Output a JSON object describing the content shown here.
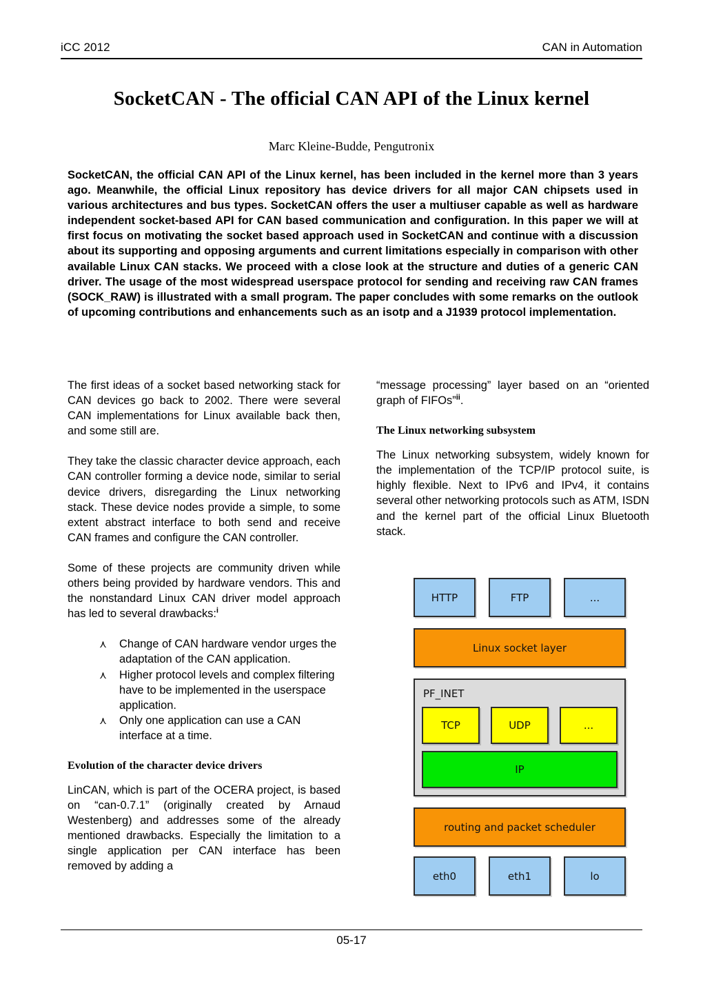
{
  "header": {
    "left": "iCC 2012",
    "right": "CAN in Automation"
  },
  "title": "SocketCAN - The official CAN API of the Linux kernel",
  "author": "Marc Kleine-Budde, Pengutronix",
  "abstract": "SocketCAN, the official CAN API of the Linux kernel, has been included in the kernel more than 3 years ago. Meanwhile, the official Linux repository has device drivers for all major CAN chipsets used in various architectures and bus types. SocketCAN offers the user a multiuser capable as well as hardware independent socket-based API for CAN based communication and configuration. In this paper we will at first focus on motivating the socket based approach used in SocketCAN and continue with a discussion about its supporting and opposing arguments and current limitations especially in comparison with other available Linux CAN stacks. We proceed with a close look at the structure and duties of a generic CAN driver. The usage of the most widespread userspace protocol for sending and receiving raw CAN frames (SOCK_RAW) is illustrated with a small program. The paper concludes with some remarks on the outlook of upcoming contributions and enhancements such as an isotp and a J1939 protocol implementation.",
  "left_column": {
    "para1": "The first ideas of a socket based networking stack for CAN devices go back to 2002. There were several CAN implementations for Linux available back then, and some still are.",
    "para2": "They take the classic character device approach, each CAN controller forming a device node, similar to serial device drivers, disregarding the Linux networking stack. These device nodes provide a simple, to some extent abstract interface to both send and receive CAN frames and configure the CAN controller.",
    "para3_before_note": "Some of these projects are community driven while others being provided by hardware vendors. This and the nonstandard Linux CAN driver model approach has led to several drawbacks:",
    "para3_note": "i",
    "bullet_glyph": "⋏",
    "bullets": [
      "Change of CAN hardware vendor urges the adaptation of the CAN application.",
      "Higher protocol levels and complex filtering have to be implemented in the userspace application.",
      "Only one application can use a CAN interface at a time."
    ],
    "subhead": "Evolution of the character device drivers",
    "para4": "LinCAN, which is part of the OCERA project, is based on “can-0.7.1” (originally created by Arnaud Westenberg) and addresses some of the already mentioned drawbacks. Especially the limitation to a single application per CAN interface has been removed by adding a"
  },
  "right_column": {
    "para1_before_note": "“message processing” layer based on an “oriented graph of FIFOs”",
    "para1_note": "ii",
    "para1_after_note": ".",
    "subhead": "The Linux networking subsystem",
    "para2": "The Linux networking subsystem, widely known for the implementation of the TCP/IP protocol suite, is highly flexible. Next to IPv6 and IPv4, it contains several other networking protocols such as ATM, ISDN and the kernel part of the official Linux Bluetooth stack."
  },
  "diagram": {
    "colors": {
      "app_blue": "#9FCDF2",
      "orange": "#F89406",
      "gray": "#DCDCDC",
      "yellow": "#FFFF00",
      "green": "#00E800",
      "stroke": "#2B2B2B"
    },
    "app_row": [
      "HTTP",
      "FTP",
      "..."
    ],
    "socket_layer": "Linux socket layer",
    "pf_inet_label": "PF_INET",
    "proto_row": [
      "TCP",
      "UDP",
      "..."
    ],
    "ip": "IP",
    "routing": "routing and packet scheduler",
    "nic_row": [
      "eth0",
      "eth1",
      "lo"
    ]
  },
  "footer": {
    "page_number": "05-17"
  }
}
